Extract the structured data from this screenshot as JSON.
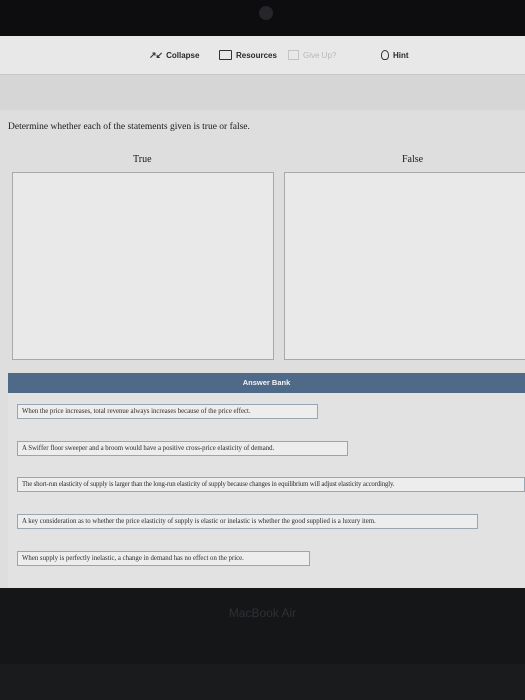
{
  "toolbar": {
    "collapse_label": "Collapse",
    "resources_label": "Resources",
    "give_up_label": "Give Up?",
    "hint_label": "Hint"
  },
  "question": {
    "prompt": "Determine whether each of the statements given is true or false."
  },
  "columns": {
    "true_label": "True",
    "false_label": "False"
  },
  "answer_bank": {
    "title": "Answer Bank",
    "items": [
      "When the price increases, total revenue always increases because of the price effect.",
      "A Swiffer floor sweeper and a broom would have a positive cross-price elasticity of demand.",
      "The short-run elasticity of supply is larger than the long-run elasticity of supply because changes in equilibrium will adjust elasticity accordingly.",
      "A key consideration as to whether the price elasticity of supply is elastic or inelastic is whether the good supplied is a luxury item.",
      "When supply is perfectly inelastic, a change in demand has no effect on the price."
    ]
  },
  "device": {
    "bezel_label": "MacBook Air"
  }
}
